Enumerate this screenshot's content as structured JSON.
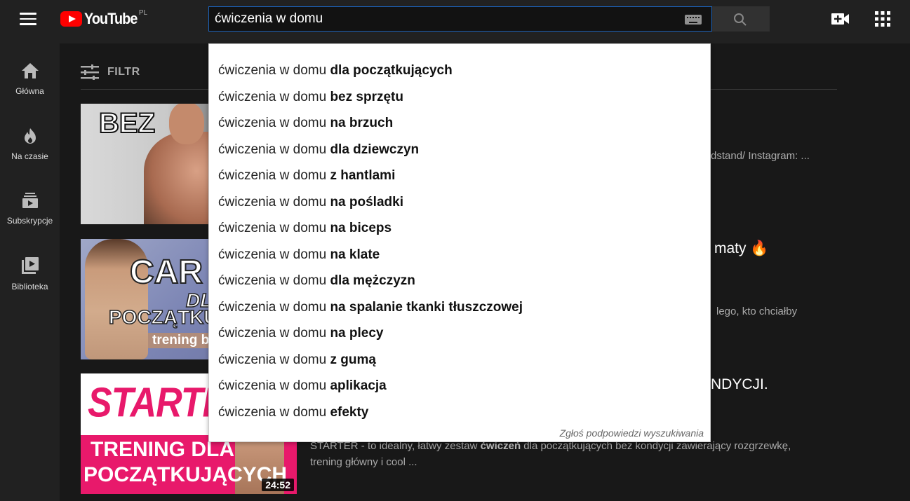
{
  "header": {
    "logo_text": "YouTube",
    "country_code": "PL",
    "search_value": "ćwiczenia w domu",
    "menu_icon": "hamburger-icon",
    "search_icon": "search-icon",
    "keyboard_icon": "keyboard-icon",
    "create_icon": "video-camera-plus-icon",
    "apps_icon": "apps-grid-icon"
  },
  "sidebar": {
    "items": [
      {
        "label": "Główna",
        "icon": "home-icon"
      },
      {
        "label": "Na czasie",
        "icon": "flame-icon"
      },
      {
        "label": "Subskrypcje",
        "icon": "subscriptions-icon"
      },
      {
        "label": "Biblioteka",
        "icon": "library-icon"
      }
    ]
  },
  "filter": {
    "label": "FILTR",
    "icon": "sliders-icon"
  },
  "suggestions": {
    "prefix": "ćwiczenia w domu ",
    "items": [
      "dla początkujących",
      "bez sprzętu",
      "na brzuch",
      "dla dziewczyn",
      "z hantlami",
      "na pośladki",
      "na biceps",
      "na klate",
      "dla mężczyzn",
      "na spalanie tkanki tłuszczowej",
      "na plecy",
      "z gumą",
      "aplikacja",
      "efekty"
    ],
    "report_label": "Zgłoś podpowiedzi wyszukiwania"
  },
  "videos": [
    {
      "thumb_text": [
        "BEZ"
      ],
      "title_visible": "",
      "desc_visible": "dstand/ Instagram: ..."
    },
    {
      "thumb_text": [
        "CAR",
        "DLA",
        "POCZĄTKU",
        "trening be"
      ],
      "title_visible": "maty 🔥",
      "desc_visible": "lego, kto chciałby"
    },
    {
      "thumb_text": [
        "STARTER",
        "TRENING DLA",
        "POCZĄTKUJĄCYCH"
      ],
      "duration": "24:52",
      "title_visible": "NDYCJI.",
      "desc_line1_a": "STARTER - to idealny, łatwy zestaw ",
      "desc_line1_b": "ćwiczeń",
      "desc_line1_c": " dla początkujących bez kondycji zawierający rozgrzewkę,",
      "desc_line2": "trening główny i cool ..."
    }
  ],
  "colors": {
    "accent_red": "#ff0000",
    "search_border": "#1c62b9",
    "starter_pink": "#e8196b"
  }
}
